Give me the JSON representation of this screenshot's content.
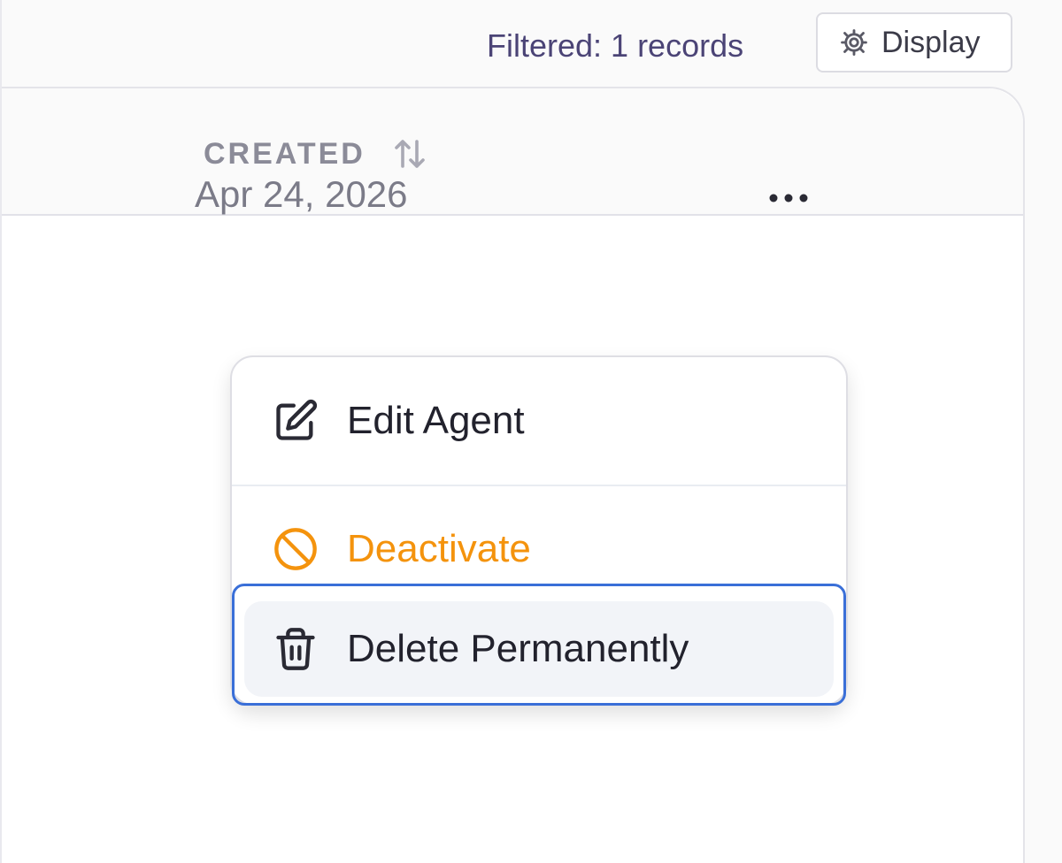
{
  "toolbar": {
    "filter_count": "Filtered: 1 records",
    "display_label": "Display",
    "display_icon": "gear-icon"
  },
  "table": {
    "columns": [
      {
        "label": "CREATED",
        "sortable": true,
        "sort_icon": "sort-arrows-icon"
      }
    ],
    "rows": [
      {
        "created": "Apr 24, 2026",
        "actions_icon": "more-horizontal-icon"
      }
    ]
  },
  "row_menu": {
    "items": [
      {
        "label": "Edit Agent",
        "icon": "edit-icon",
        "color": "#22222d"
      },
      {
        "label": "Deactivate",
        "icon": "ban-icon",
        "color": "#f4930d"
      },
      {
        "label": "Delete Permanently",
        "icon": "trash-icon",
        "color": "#22222d",
        "focused": true
      }
    ]
  },
  "colors": {
    "accent_focus": "#3a6fd8",
    "warning": "#f4930d",
    "header_text": "#8b8b98",
    "muted_text": "#7b7b88"
  }
}
